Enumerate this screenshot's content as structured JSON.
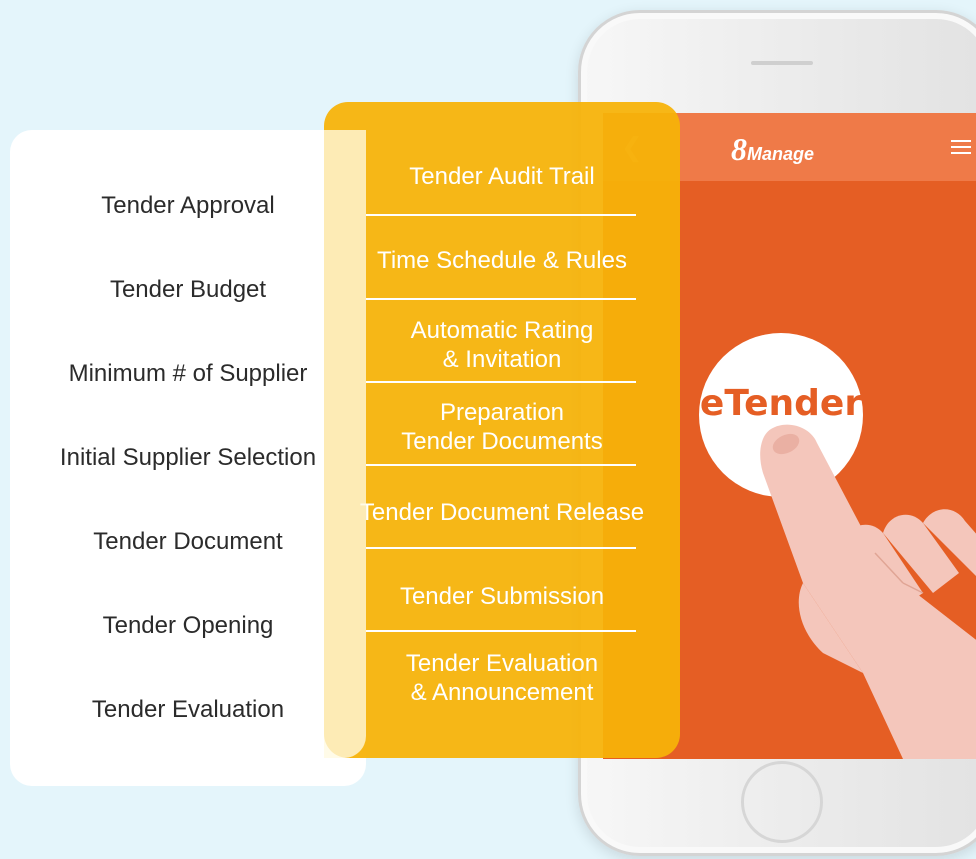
{
  "left_list": {
    "items": [
      "Tender Approval",
      "Tender Budget",
      "Minimum # of Supplier",
      "Initial Supplier Selection",
      "Tender Document",
      "Tender Opening",
      "Tender Evaluation"
    ]
  },
  "yellow_list": {
    "items": [
      [
        "Tender Audit Trail"
      ],
      [
        "Time Schedule & Rules"
      ],
      [
        "Automatic Rating",
        "& Invitation"
      ],
      [
        "Preparation",
        "Tender Documents"
      ],
      [
        "Tender Document Release"
      ],
      [
        "Tender Submission"
      ],
      [
        "Tender Evaluation",
        "& Announcement"
      ]
    ]
  },
  "app": {
    "logo_number": "8",
    "logo_word": "Manage",
    "center_label": "eTender",
    "back_icon": "chevron-left-icon",
    "menu_icon": "hamburger-menu-icon"
  },
  "colors": {
    "screen_orange": "#e55e24",
    "header_orange": "#ef7a48",
    "panel_yellow": "#f6b208",
    "background": "#e4f5fb"
  }
}
